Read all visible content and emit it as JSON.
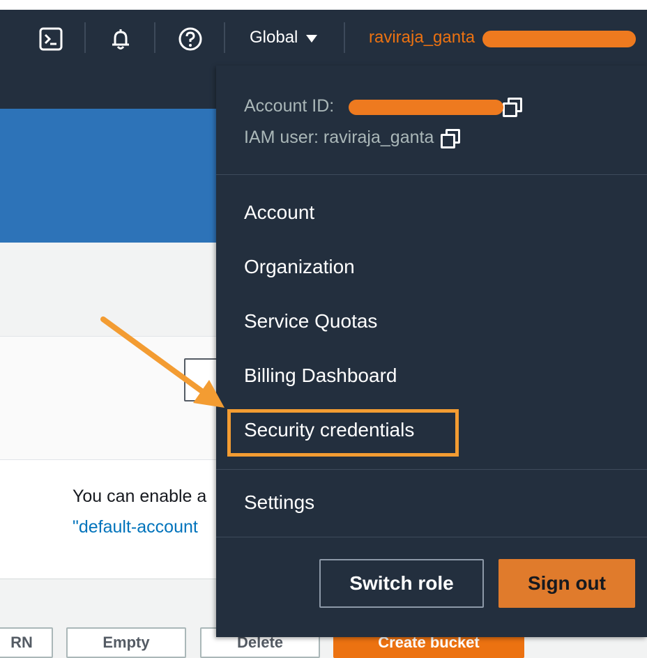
{
  "nav": {
    "region_label": "Global",
    "username": "raviraja_ganta",
    "icons": [
      "cloudshell-icon",
      "bell-icon",
      "help-icon"
    ]
  },
  "dropdown": {
    "account_id_label": "Account ID:",
    "iam_user_label": "IAM user: raviraja_ganta",
    "items": [
      {
        "label": "Account"
      },
      {
        "label": "Organization"
      },
      {
        "label": "Service Quotas"
      },
      {
        "label": "Billing Dashboard"
      },
      {
        "label": "Security credentials",
        "highlighted": true
      },
      {
        "label": "Settings"
      }
    ],
    "switch_role_label": "Switch role",
    "sign_out_label": "Sign out"
  },
  "background": {
    "card_text": "You can enable a",
    "card_link": "\"default-account",
    "bottom_buttons": [
      "RN",
      "Empty",
      "Delete",
      "Create bucket"
    ]
  },
  "colors": {
    "nav_bg": "#232f3e",
    "accent_orange": "#ec7211",
    "highlight_orange": "#f39c32",
    "banner_blue": "#2d73b8"
  }
}
